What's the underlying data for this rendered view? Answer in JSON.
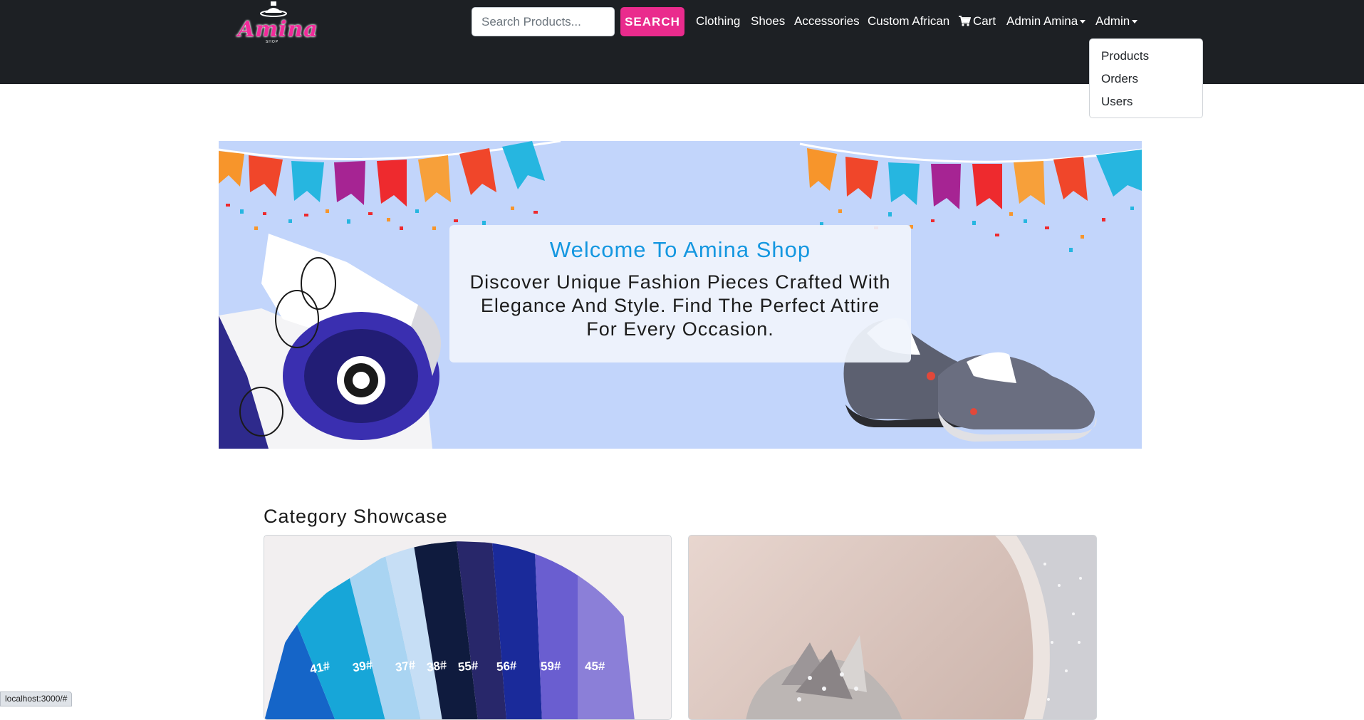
{
  "brand": {
    "logo_text": "Amina",
    "logo_sub": "SHOP"
  },
  "search": {
    "placeholder": "Search Products...",
    "button_label": "SEARCH"
  },
  "nav": {
    "clothing": "Clothing",
    "shoes": "Shoes",
    "accessories": "Accessories",
    "custom_african": "Custom African",
    "cart": "Cart",
    "user_menu": "Admin Amina",
    "admin_menu": "Admin"
  },
  "admin_dropdown": {
    "items": [
      "Products",
      "Orders",
      "Users"
    ]
  },
  "hero": {
    "title": "Welcome To Amina Shop",
    "text": "Discover Unique Fashion Pieces Crafted With Elegance And Style. Find The Perfect Attire For Every Occasion."
  },
  "category_showcase": {
    "title": "Category Showcase"
  },
  "fabric_labels": [
    "41#",
    "39#",
    "37#",
    "38#",
    "55#",
    "56#",
    "59#",
    "45#"
  ],
  "status_bar": {
    "url": "localhost:3000/#"
  },
  "colors": {
    "navbar": "#1d2024",
    "accent": "#ea2b8d",
    "hero_title": "#1497e0",
    "banner_bg": "#c2d5fb"
  },
  "icons": {
    "cart": "cart-icon",
    "caret": "caret-down-icon"
  }
}
